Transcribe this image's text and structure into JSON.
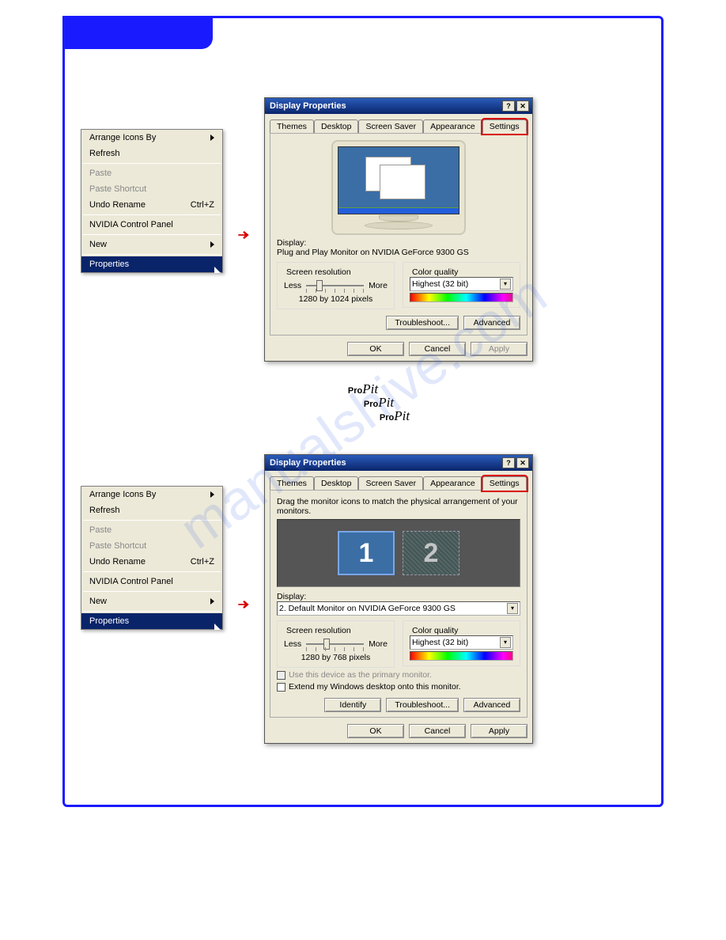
{
  "contextMenu": {
    "arrange": "Arrange Icons By",
    "refresh": "Refresh",
    "paste": "Paste",
    "pasteShortcut": "Paste Shortcut",
    "undoRename": "Undo Rename",
    "undoRenameKey": "Ctrl+Z",
    "nvidia": "NVIDIA Control Panel",
    "new": "New",
    "properties": "Properties"
  },
  "dialog1": {
    "title": "Display Properties",
    "tabs": {
      "themes": "Themes",
      "desktop": "Desktop",
      "ss": "Screen Saver",
      "appearance": "Appearance",
      "settings": "Settings"
    },
    "displayLabel": "Display:",
    "displayValue": "Plug and Play Monitor on NVIDIA GeForce 9300 GS",
    "resLegend": "Screen resolution",
    "less": "Less",
    "more": "More",
    "resValue": "1280 by 1024 pixels",
    "cqLegend": "Color quality",
    "cqValue": "Highest (32 bit)",
    "troubleshoot": "Troubleshoot...",
    "advanced": "Advanced",
    "ok": "OK",
    "cancel": "Cancel",
    "apply": "Apply"
  },
  "dialog2": {
    "title": "Display Properties",
    "tabs": {
      "themes": "Themes",
      "desktop": "Desktop",
      "ss": "Screen Saver",
      "appearance": "Appearance",
      "settings": "Settings"
    },
    "drag": "Drag the monitor icons to match the physical arrangement of your monitors.",
    "m1": "1",
    "m2": "2",
    "displayLabel": "Display:",
    "displayValue": "2. Default Monitor on NVIDIA GeForce 9300 GS",
    "resLegend": "Screen resolution",
    "less": "Less",
    "more": "More",
    "resValue": "1280 by 768 pixels",
    "cqLegend": "Color quality",
    "cqValue": "Highest (32 bit)",
    "primary": "Use this device as the primary monitor.",
    "extend": "Extend my Windows desktop onto this monitor.",
    "identify": "Identify",
    "troubleshoot": "Troubleshoot...",
    "advanced": "Advanced",
    "ok": "OK",
    "cancel": "Cancel",
    "apply": "Apply"
  },
  "propit": {
    "pro": "Pro",
    "pit": "Pit"
  },
  "watermark": "manualshive.com"
}
